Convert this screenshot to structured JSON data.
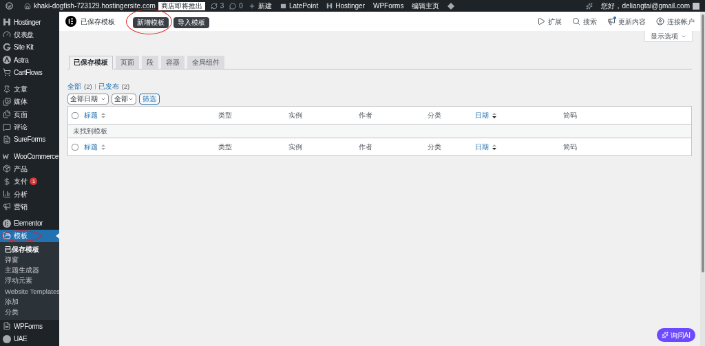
{
  "admin_bar": {
    "site": "khaki-dogfish-723129.hostingersite.com",
    "badge": "商店即将推出",
    "updates": "3",
    "comments": "0",
    "new": "新建",
    "links": [
      {
        "label": "LatePoint",
        "kind": "latepoint"
      },
      {
        "label": "Hostinger",
        "kind": "hostinger"
      },
      {
        "label": "WPForms",
        "kind": "plain"
      },
      {
        "label": "编辑主页",
        "kind": "plain"
      }
    ],
    "greeting": "您好，deliangtai@gmail.com"
  },
  "sidebar": {
    "groups": [
      {
        "items": [
          {
            "label": "Hostinger",
            "kind": "hostinger",
            "selected": false
          },
          {
            "label": "仪表盘",
            "kind": "gauge",
            "selected": false
          },
          {
            "label": "Site Kit",
            "kind": "g",
            "selected": false
          },
          {
            "label": "Astra",
            "kind": "astra",
            "selected": false
          },
          {
            "label": "CartFlows",
            "kind": "cart",
            "selected": false
          }
        ]
      },
      {
        "items": [
          {
            "label": "文章",
            "kind": "pin",
            "selected": false
          },
          {
            "label": "媒体",
            "kind": "media",
            "selected": false
          },
          {
            "label": "页面",
            "kind": "page",
            "selected": false
          },
          {
            "label": "评论",
            "kind": "comment",
            "selected": false
          },
          {
            "label": "SureForms",
            "kind": "form",
            "selected": false
          }
        ]
      },
      {
        "items": [
          {
            "label": "WooCommerce",
            "kind": "woo",
            "selected": false
          },
          {
            "label": "产品",
            "kind": "box",
            "selected": false
          },
          {
            "label": "支付",
            "kind": "dollar",
            "selected": false,
            "badge": "1"
          },
          {
            "label": "分析",
            "kind": "chart",
            "selected": false
          },
          {
            "label": "营销",
            "kind": "megaphone",
            "selected": false
          }
        ]
      },
      {
        "items": [
          {
            "label": "Elementor",
            "kind": "elementor",
            "selected": false
          },
          {
            "label": "模板",
            "kind": "folder",
            "selected": true,
            "annotated": true,
            "children": [
              {
                "label": "已保存模板",
                "selected": true
              },
              {
                "label": "弹窗",
                "selected": false
              },
              {
                "label": "主题生成器",
                "selected": false
              },
              {
                "label": "浮动元素",
                "selected": false
              },
              {
                "label": "Website Templates",
                "selected": false
              },
              {
                "label": "添加",
                "selected": false
              },
              {
                "label": "分类",
                "selected": false
              }
            ]
          },
          {
            "label": "WPForms",
            "kind": "form",
            "selected": false
          },
          {
            "label": "UAE",
            "kind": "uae",
            "selected": false
          }
        ]
      }
    ]
  },
  "header": {
    "title": "已保存模板",
    "buttons": [
      {
        "label": "新增模板",
        "annotated": true
      },
      {
        "label": "导入模板",
        "annotated": false
      }
    ],
    "tools": [
      {
        "label": "扩展",
        "kind": "play",
        "notify": false
      },
      {
        "label": "搜索",
        "kind": "search",
        "notify": false
      },
      {
        "label": "更新内容",
        "kind": "megaphone",
        "notify": true
      },
      {
        "label": "连接帐户",
        "kind": "user",
        "notify": false
      }
    ]
  },
  "screen_options": "显示选项",
  "tabs": [
    {
      "label": "已保存模板",
      "selected": true
    },
    {
      "label": "页面",
      "selected": false
    },
    {
      "label": "段",
      "selected": false
    },
    {
      "label": "容器",
      "selected": false
    },
    {
      "label": "全局组件",
      "selected": false
    }
  ],
  "views": [
    {
      "label": "全部",
      "count": "(2)"
    },
    {
      "label": "已发布",
      "count": "(2)"
    }
  ],
  "filters": {
    "date": "全部日期",
    "type": "全部",
    "button": "筛选"
  },
  "table": {
    "header": [
      {
        "label": "标题",
        "sorted": false,
        "checked": false
      },
      {
        "label": "类型"
      },
      {
        "label": "实例"
      },
      {
        "label": "作者"
      },
      {
        "label": "分类"
      },
      {
        "label": "日期",
        "sorted": true
      },
      {
        "label": "简码"
      }
    ],
    "empty_message": "未找到模板",
    "footer": [
      {
        "label": "标题",
        "sorted": false,
        "checked": false
      },
      {
        "label": "类型"
      },
      {
        "label": "实例"
      },
      {
        "label": "作者"
      },
      {
        "label": "分类"
      },
      {
        "label": "日期",
        "sorted": true
      },
      {
        "label": "简码"
      }
    ]
  },
  "ask_ai": "询问AI"
}
